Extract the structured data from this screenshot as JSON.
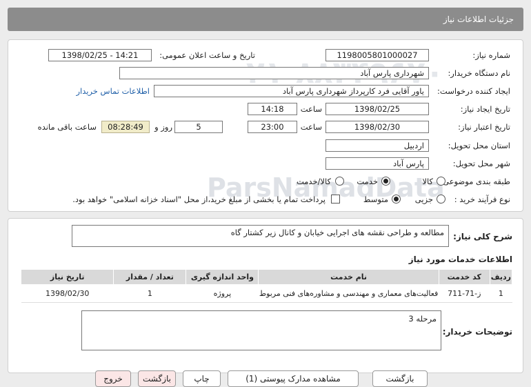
{
  "header": {
    "title": "جزئیات اطلاعات نیاز"
  },
  "fields": {
    "need_number_label": "شماره نیاز:",
    "need_number": "1198005801000027",
    "announce_label": "تاریخ و ساعت اعلان عمومی:",
    "announce_value": "1398/02/25 - 14:21",
    "buyer_org_label": "نام دستگاه خریدار:",
    "buyer_org": "شهرداری پارس آباد",
    "requester_label": "ایجاد کننده درخواست:",
    "requester": "یاور آقایی فرد کارپرداز شهرداری پارس آباد",
    "contact_link": "اطلاعات تماس خریدار",
    "created_label": "تاریخ ایجاد نیاز:",
    "created_date": "1398/02/25",
    "time_label": "ساعت",
    "created_time": "14:18",
    "validity_label": "تاریخ اعتبار نیاز:",
    "validity_date": "1398/02/30",
    "validity_time": "23:00",
    "days_value": "5",
    "days_label": "روز و",
    "remaining_time": "08:28:49",
    "remaining_label": "ساعت باقی مانده",
    "province_label": "استان محل تحویل:",
    "province": "اردبیل",
    "city_label": "شهر محل تحویل:",
    "city": "پارس آباد",
    "category_label": "طبقه بندی موضوعی:",
    "category_options": [
      "کالا",
      "خدمت",
      "کالا/خدمت"
    ],
    "process_label": "نوع فرآیند خرید :",
    "process_options": [
      "جزیی",
      "متوسط"
    ],
    "payment_note": "پرداخت تمام یا بخشی از مبلغ خرید،از محل \"اسناد خزانه اسلامی\" خواهد بود."
  },
  "summary": {
    "label": "شرح کلی نیاز:",
    "text": "مطالعه و طراحی نقشه های اجرایی خیابان و کانال زیر کشتار گاه"
  },
  "services": {
    "title": "اطلاعات خدمات مورد نیاز",
    "columns": [
      "ردیف",
      "کد خدمت",
      "نام خدمت",
      "واحد اندازه گیری",
      "تعداد / مقدار",
      "تاریخ نیاز"
    ],
    "rows": [
      [
        "1",
        "ز-71-711",
        "فعالیت‌های معماری و مهندسی و مشاوره‌های فنی مربوط",
        "پروژه",
        "1",
        "1398/02/30"
      ]
    ]
  },
  "buyer_notes": {
    "label": "توضیحات خریدار:",
    "text": "مرحله 3"
  },
  "watermark": {
    "brand": "ParsNamadData",
    "line1": "پایگاه اطلاع رسانی مناقصه ومزایده",
    "line2": "پارس نماد داده ها",
    "phone": "۰۲۱-۸۸۳۴۹۶۷۰"
  },
  "footer_buttons": [
    "بازگشت",
    "مشاهده مدارک پیوستی (1)",
    "چاپ",
    "بازگشت",
    "خروج"
  ]
}
